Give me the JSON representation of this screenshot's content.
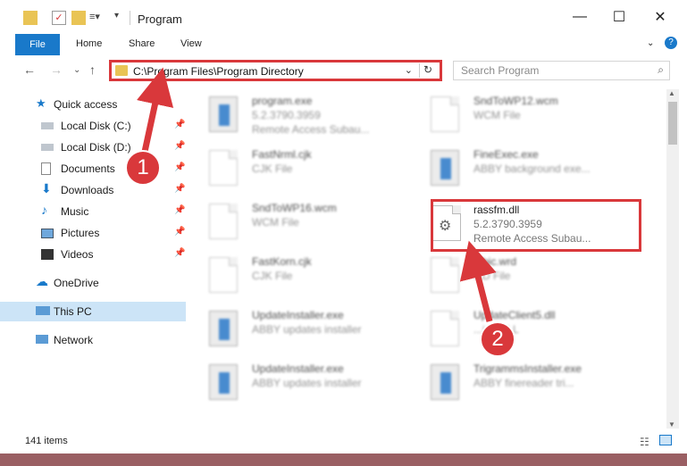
{
  "window": {
    "title": "Program",
    "controls": [
      "minimize-icon",
      "maximize-icon",
      "close-icon"
    ]
  },
  "ribbon": {
    "tabs": [
      "File",
      "Home",
      "Share",
      "View"
    ]
  },
  "address_bar": {
    "path": "C:\\Program Files\\Program Directory"
  },
  "search": {
    "placeholder": "Search Program"
  },
  "nav_pane": {
    "quick_access": "Quick access",
    "items": [
      {
        "label": "Local Disk (C:)",
        "icon": "drive-icon",
        "pinned": true
      },
      {
        "label": "Local Disk (D:)",
        "icon": "drive-icon",
        "pinned": true
      },
      {
        "label": "Documents",
        "icon": "documents-icon",
        "pinned": true
      },
      {
        "label": "Downloads",
        "icon": "download-icon",
        "pinned": true
      },
      {
        "label": "Music",
        "icon": "music-icon",
        "pinned": true
      },
      {
        "label": "Pictures",
        "icon": "pictures-icon",
        "pinned": true
      },
      {
        "label": "Videos",
        "icon": "videos-icon",
        "pinned": true
      }
    ],
    "onedrive": "OneDrive",
    "this_pc": "This PC",
    "network": "Network"
  },
  "files": [
    {
      "name": "program.exe",
      "line2": "5.2.3790.3959",
      "line3": "Remote Access Subau...",
      "icon": "exe-icon"
    },
    {
      "name": "SndToWP12.wcm",
      "line2": "WCM File",
      "line3": "",
      "icon": "file-icon"
    },
    {
      "name": "FastNrml.cjk",
      "line2": "CJK File",
      "line3": "",
      "icon": "file-icon"
    },
    {
      "name": "FineExec.exe",
      "line2": "ABBY background exe...",
      "line3": "",
      "icon": "app-icon"
    },
    {
      "name": "SndToWP16.wcm",
      "line2": "WCM File",
      "line3": "",
      "icon": "file-icon"
    },
    {
      "name": "rassfm.dll",
      "line2": "5.2.3790.3959",
      "line3": "Remote Access Subau...",
      "icon": "dll-gear-icon"
    },
    {
      "name": "FastKorn.cjk",
      "line2": "CJK File",
      "line3": "",
      "icon": "file-icon"
    },
    {
      "name": "...bic.wrd",
      "line2": "...D File",
      "line3": "",
      "icon": "file-icon"
    },
    {
      "name": "UpdateInstaller.exe",
      "line2": "ABBY updates installer",
      "line3": "",
      "icon": "app-icon"
    },
    {
      "name": "UpdateClient5.dll",
      "line2": "...ice DLL",
      "line3": "",
      "icon": "dll-gear-icon"
    },
    {
      "name": "UpdateInstaller.exe",
      "line2": "ABBY updates installer",
      "line3": "",
      "icon": "app-icon"
    },
    {
      "name": "TrigrammsInstaller.exe",
      "line2": "ABBY finereader tri...",
      "line3": "",
      "icon": "app-icon"
    }
  ],
  "status": {
    "count": "141 items"
  },
  "callouts": [
    "1",
    "2"
  ],
  "colors": {
    "accent": "#1979ca",
    "highlight": "#d9383b",
    "selection": "#cce4f7",
    "folder": "#e9c455"
  }
}
